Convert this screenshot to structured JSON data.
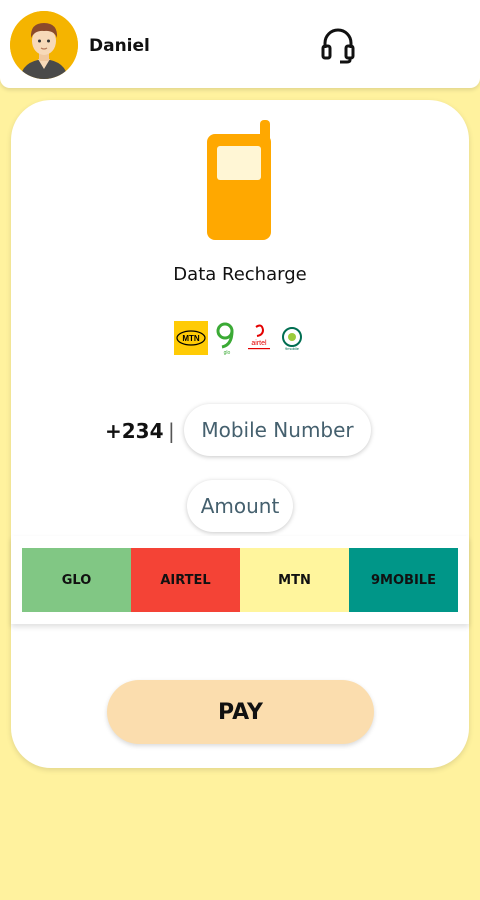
{
  "header": {
    "user_name": "Daniel",
    "avatar_icon": "user-avatar",
    "support_icon": "headset-icon"
  },
  "card": {
    "icon": "mobile-phone-icon",
    "title": "Data Recharge",
    "logos": {
      "mtn": "MTN",
      "glo": "glo",
      "airtel": "airtel",
      "ninemobile": "9mobile"
    },
    "country_code": "+234",
    "separator": "|",
    "mobile_placeholder": "Mobile Number",
    "amount_placeholder": "Amount",
    "networks": [
      {
        "label": "GLO",
        "color": "#81C784"
      },
      {
        "label": "AIRTEL",
        "color": "#F44336"
      },
      {
        "label": "MTN",
        "color": "#FFF59D"
      },
      {
        "label": "9MOBILE",
        "color": "#009688"
      }
    ],
    "pay_label": "PAY"
  },
  "colors": {
    "background": "#FFF29E",
    "phone": "#FFA800",
    "pay_button": "#FBDDAE"
  }
}
